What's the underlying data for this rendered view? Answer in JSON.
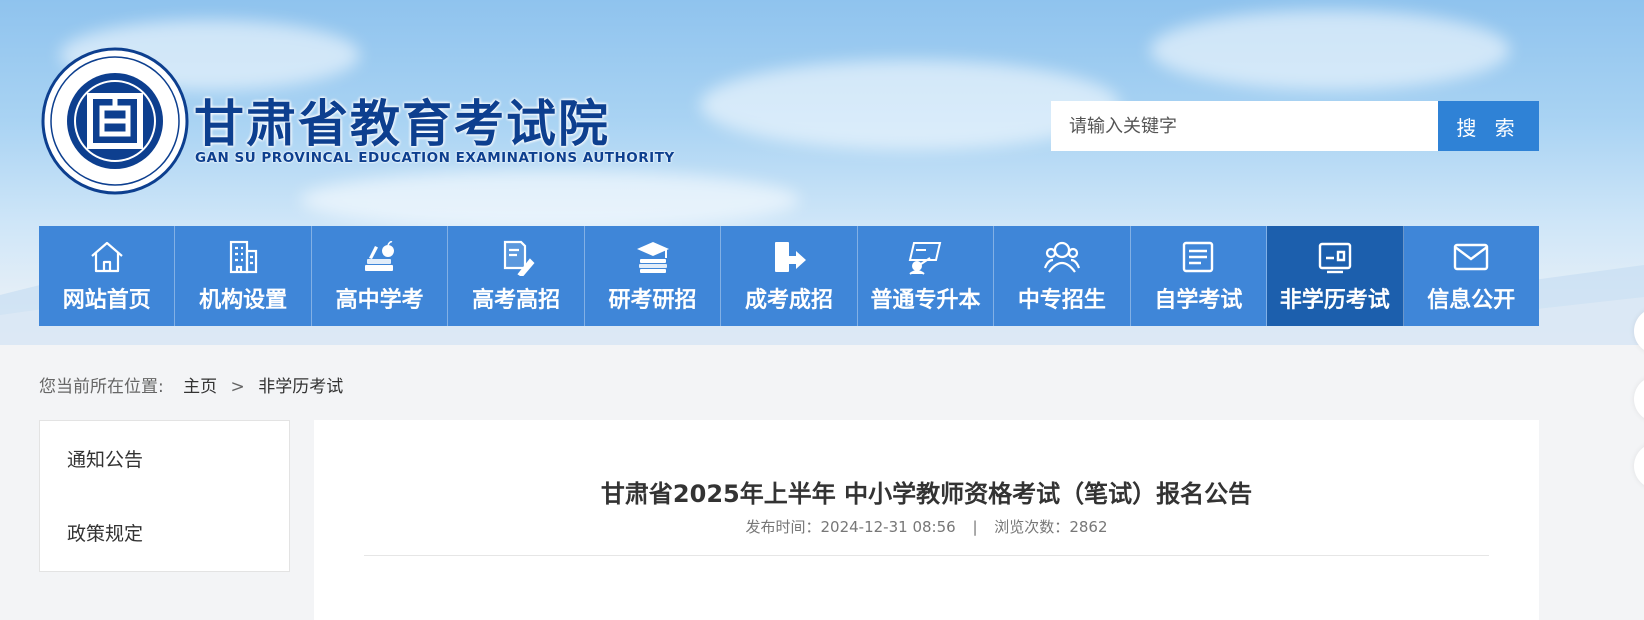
{
  "header": {
    "brand_cn": "甘肃省教育考试院",
    "brand_en": "GAN SU PROVINCAL EDUCATION EXAMINATIONS AUTHORITY",
    "logo_icon": "emblem-icon",
    "colors": {
      "brand": "#0d3f8f",
      "nav": "#3f86d8",
      "nav_active": "#1c5fad",
      "search_button": "#2f82d6"
    }
  },
  "search": {
    "placeholder": "请输入关键字",
    "value": "",
    "button_label": "搜 索"
  },
  "nav": {
    "items": [
      {
        "label": "网站首页",
        "icon": "home-icon"
      },
      {
        "label": "机构设置",
        "icon": "building-icon"
      },
      {
        "label": "高中学考",
        "icon": "books-apple-icon"
      },
      {
        "label": "高考高招",
        "icon": "exam-pen-icon"
      },
      {
        "label": "研考研招",
        "icon": "graduation-cap-icon"
      },
      {
        "label": "成考成招",
        "icon": "book-arrow-icon"
      },
      {
        "label": "普通专升本",
        "icon": "teacher-board-icon"
      },
      {
        "label": "中专招生",
        "icon": "users-icon"
      },
      {
        "label": "自学考试",
        "icon": "document-lines-icon"
      },
      {
        "label": "非学历考试",
        "icon": "id-card-icon",
        "active": true
      },
      {
        "label": "信息公开",
        "icon": "envelope-icon"
      }
    ]
  },
  "breadcrumb": {
    "prefix": "您当前所在位置:",
    "home": "主页",
    "separator": ">",
    "current": "非学历考试"
  },
  "sidebar": {
    "items": [
      {
        "label": "通知公告"
      },
      {
        "label": "政策规定"
      }
    ]
  },
  "article": {
    "title": "甘肃省2025年上半年 中小学教师资格考试（笔试）报名公告",
    "publish_label": "发布时间：",
    "publish_time": "2024-12-31 08:56",
    "separator": "|",
    "views_label": "浏览次数：",
    "views": "2862"
  }
}
